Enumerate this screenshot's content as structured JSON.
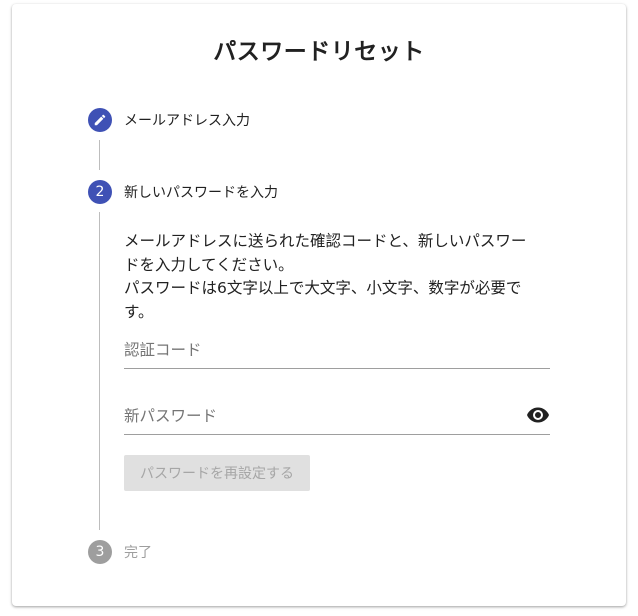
{
  "page": {
    "title": "パスワードリセット"
  },
  "steps": [
    {
      "marker": "pencil",
      "label": "メールアドレス入力",
      "state": "completed"
    },
    {
      "marker": "2",
      "label": "新しいパスワードを入力",
      "state": "active"
    },
    {
      "marker": "3",
      "label": "完了",
      "state": "inactive"
    }
  ],
  "form": {
    "description_line1": "メールアドレスに送られた確認コードと、新しいパスワー",
    "description_line2": "ドを入力してください。",
    "description_line3": "パスワードは6文字以上で大文字、小文字、数字が必要で",
    "description_line4": "す。",
    "code_placeholder": "認証コード",
    "code_value": "",
    "password_placeholder": "新パスワード",
    "password_value": "",
    "submit_label": "パスワードを再設定する",
    "submit_enabled": false
  },
  "icons": {
    "step1": "pencil-icon",
    "password_toggle": "eye-icon"
  },
  "colors": {
    "accent": "#3f51b5",
    "inactive_step": "#9e9e9e",
    "disabled_button_bg": "#e0e0e0",
    "disabled_button_text": "#a6a6a6"
  }
}
